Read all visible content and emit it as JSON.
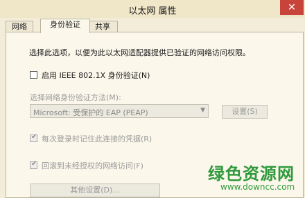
{
  "window": {
    "title": "以太网 属性",
    "close_glyph": "✕"
  },
  "tabs": [
    {
      "label": "网络"
    },
    {
      "label": "身份验证"
    },
    {
      "label": "共享"
    }
  ],
  "auth": {
    "description": "选择此选项，以便为此以太网适配器提供已验证的网络访问权限。",
    "enable_8021x": {
      "label": "启用 IEEE 802.1X 身份验证(N)",
      "checked": false
    },
    "method_label": "选择网络身份验证方法(M):",
    "method_selected": "Microsoft: 受保护的 EAP (PEAP)",
    "settings_button": "设置(S)",
    "remember_credentials": {
      "label": "每次登录时记住此连接的凭据(R)",
      "checked": true
    },
    "fallback_unauthorized": {
      "label": "回滚到未经授权的网络访问(F)",
      "checked": true
    },
    "other_settings_button": "其他设置(D)..."
  },
  "watermark": {
    "title": "绿色资源网",
    "url": "www.downcc.com",
    "color": "#2f9a3c"
  },
  "icons": {
    "dropdown": "chevron-down-icon",
    "check": "checkmark-icon",
    "close": "close-icon"
  }
}
